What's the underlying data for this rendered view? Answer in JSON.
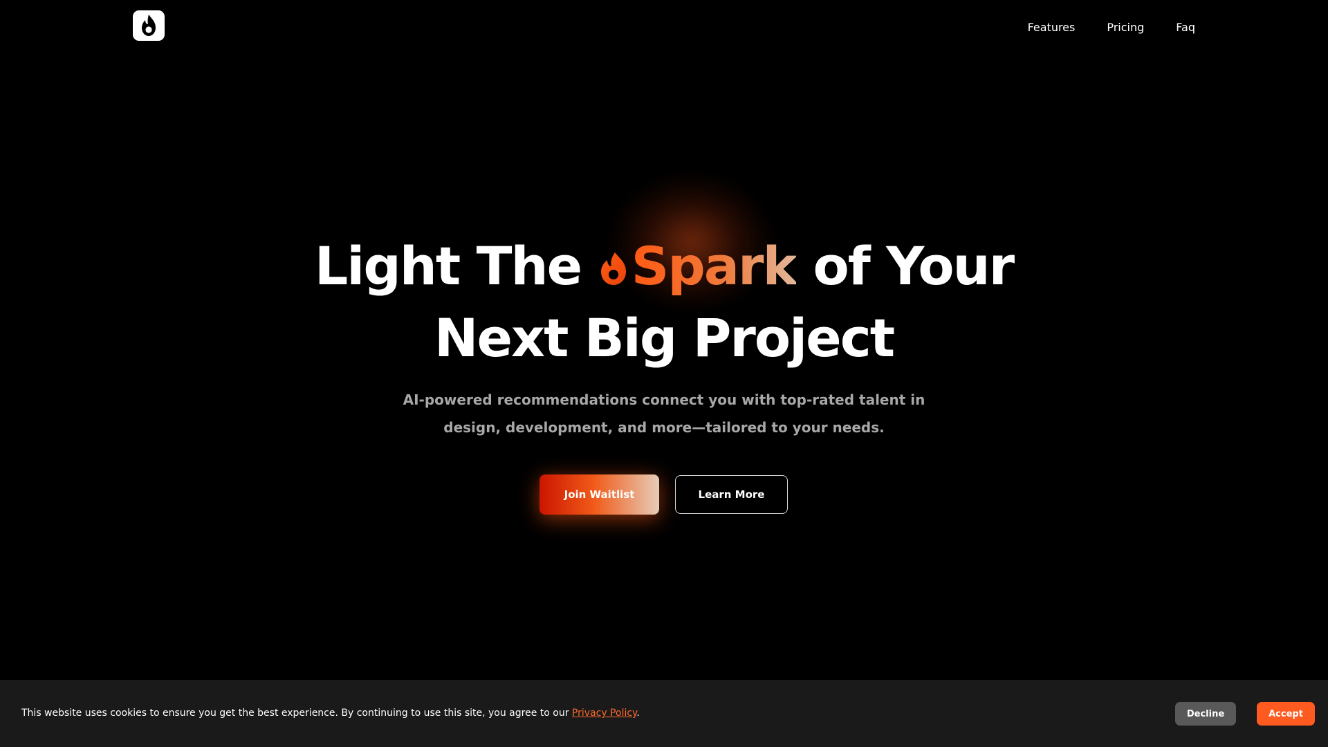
{
  "brand": {
    "logo_icon": "flame-logo-icon"
  },
  "nav": {
    "items": [
      {
        "label": "Features"
      },
      {
        "label": "Pricing"
      },
      {
        "label": "Faq"
      }
    ]
  },
  "hero": {
    "title_prefix": "Light The ",
    "title_highlight": "Spark",
    "title_suffix": " of Your",
    "title_line2": "Next Big Project",
    "highlight_icon": "flame-icon",
    "subtitle_line1": "AI-powered recommendations connect you with top-rated talent in",
    "subtitle_line2": "design, development, and more—tailored to your needs.",
    "primary_cta": "Join Waitlist",
    "secondary_cta": "Learn More"
  },
  "cookie_banner": {
    "text": "This website uses cookies to ensure you get the best experience. By continuing to use this site, you agree to our ",
    "link_label": "Privacy Policy",
    "text_end": ".",
    "decline_label": "Decline",
    "accept_label": "Accept"
  },
  "colors": {
    "background": "#000000",
    "accent": "#ff5a1f",
    "banner": "#1a1a1a",
    "muted_text": "#a8a8a8"
  }
}
